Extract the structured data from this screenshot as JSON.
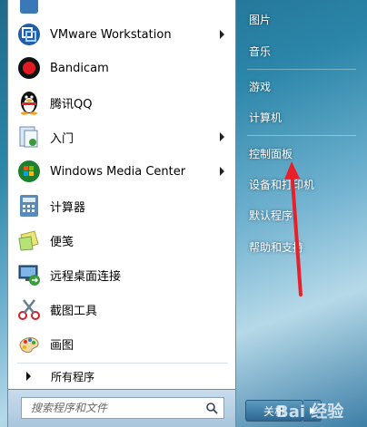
{
  "programs": [
    {
      "label": "",
      "icon": "program-icon",
      "has_arrow": false
    },
    {
      "label": "VMware Workstation",
      "icon": "vmware-icon",
      "has_arrow": true
    },
    {
      "label": "Bandicam",
      "icon": "bandicam-icon",
      "has_arrow": false
    },
    {
      "label": "腾讯QQ",
      "icon": "qq-penguin-icon",
      "has_arrow": false
    },
    {
      "label": "入门",
      "icon": "getting-started-icon",
      "has_arrow": true
    },
    {
      "label": "Windows Media Center",
      "icon": "media-center-icon",
      "has_arrow": true
    },
    {
      "label": "计算器",
      "icon": "calculator-icon",
      "has_arrow": false
    },
    {
      "label": "便笺",
      "icon": "sticky-notes-icon",
      "has_arrow": false
    },
    {
      "label": "远程桌面连接",
      "icon": "remote-desktop-icon",
      "has_arrow": false
    },
    {
      "label": "截图工具",
      "icon": "snipping-tool-icon",
      "has_arrow": false
    },
    {
      "label": "画图",
      "icon": "paint-icon",
      "has_arrow": false
    }
  ],
  "all_programs": {
    "label": "所有程序"
  },
  "search": {
    "placeholder": "搜索程序和文件"
  },
  "right_items": [
    {
      "label": "图片"
    },
    {
      "label": "音乐"
    },
    {
      "label": "游戏"
    },
    {
      "label": "计算机"
    },
    {
      "label": "控制面板"
    },
    {
      "label": "设备和打印机"
    },
    {
      "label": "默认程序"
    },
    {
      "label": "帮助和支持"
    }
  ],
  "shutdown": {
    "label": "关机"
  },
  "watermark": {
    "text": "Bai 经验"
  },
  "colors": {
    "annotation_arrow": "#e8202a",
    "panel_border": "#6e8ba3"
  }
}
